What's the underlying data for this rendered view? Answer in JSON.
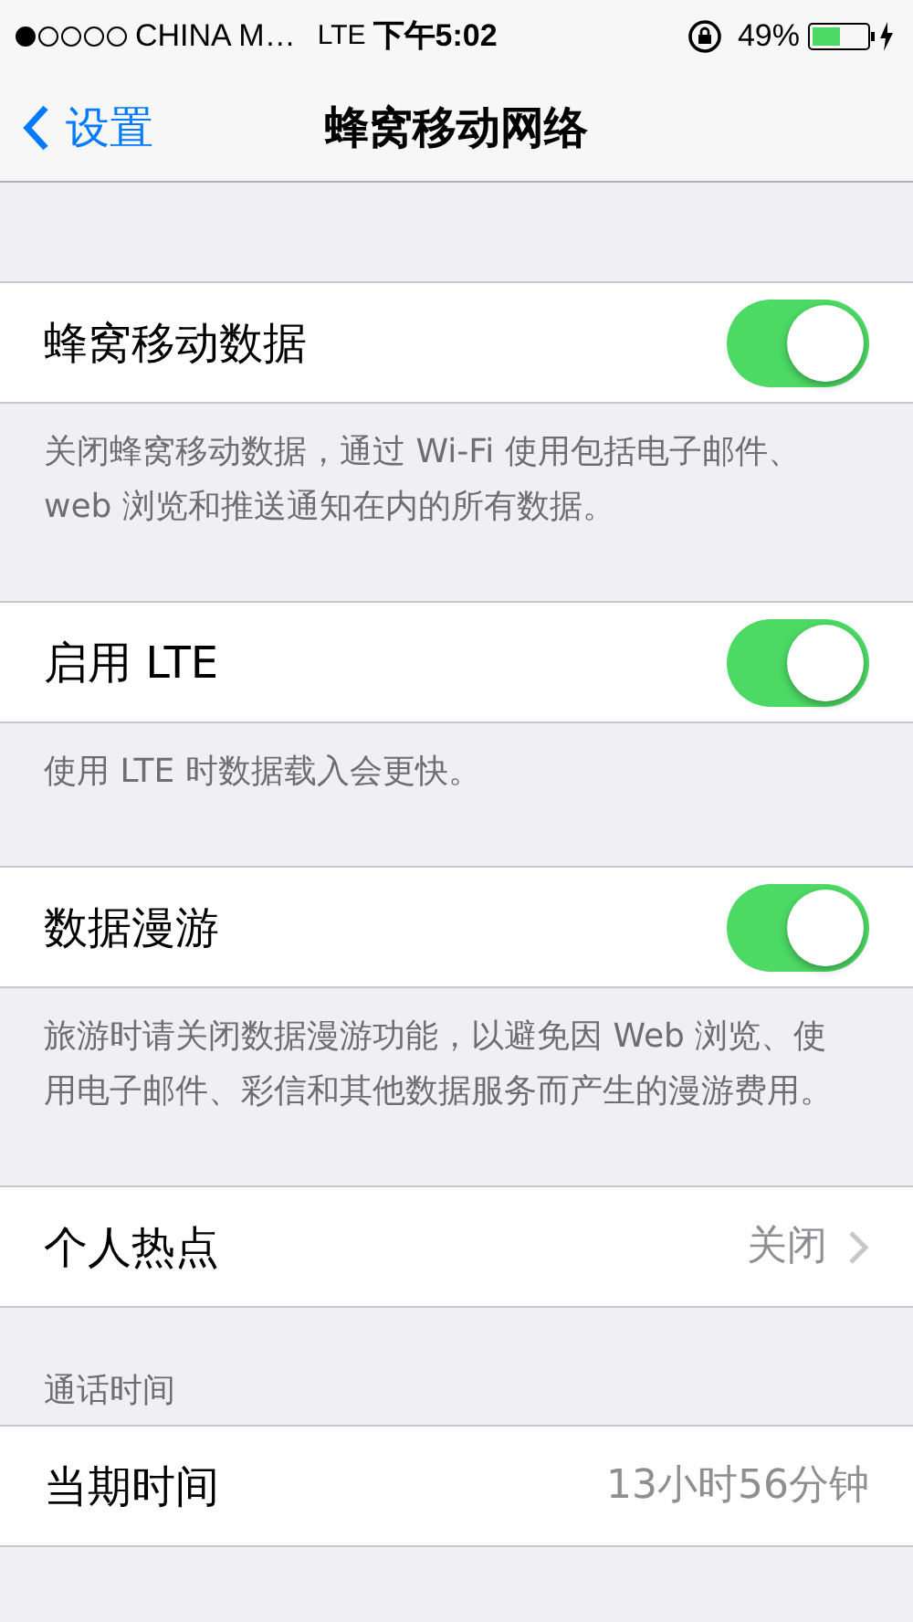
{
  "status_bar": {
    "carrier": "CHINA M…",
    "network": "LTE",
    "time": "下午5:02",
    "battery": "49%"
  },
  "nav": {
    "back": "设置",
    "title": "蜂窝移动网络"
  },
  "groups": [
    {
      "cells": [
        {
          "kind": "switch",
          "label": "蜂窝移动数据",
          "on": true
        }
      ],
      "footer": "关闭蜂窝移动数据，通过 Wi-Fi 使用包括电子邮件、web 浏览和推送通知在内的所有数据。"
    },
    {
      "cells": [
        {
          "kind": "switch",
          "label": "启用 LTE",
          "on": true
        }
      ],
      "footer": "使用 LTE 时数据载入会更快。"
    },
    {
      "cells": [
        {
          "kind": "switch",
          "label": "数据漫游",
          "on": true
        }
      ],
      "footer": "旅游时请关闭数据漫游功能，以避免因 Web 浏览、使用电子邮件、彩信和其他数据服务而产生的漫游费用。"
    },
    {
      "cells": [
        {
          "kind": "link",
          "label": "个人热点",
          "value": "关闭"
        }
      ]
    },
    {
      "header": "通话时间",
      "cells": [
        {
          "kind": "value",
          "label": "当期时间",
          "value": "13小时56分钟"
        }
      ]
    }
  ]
}
